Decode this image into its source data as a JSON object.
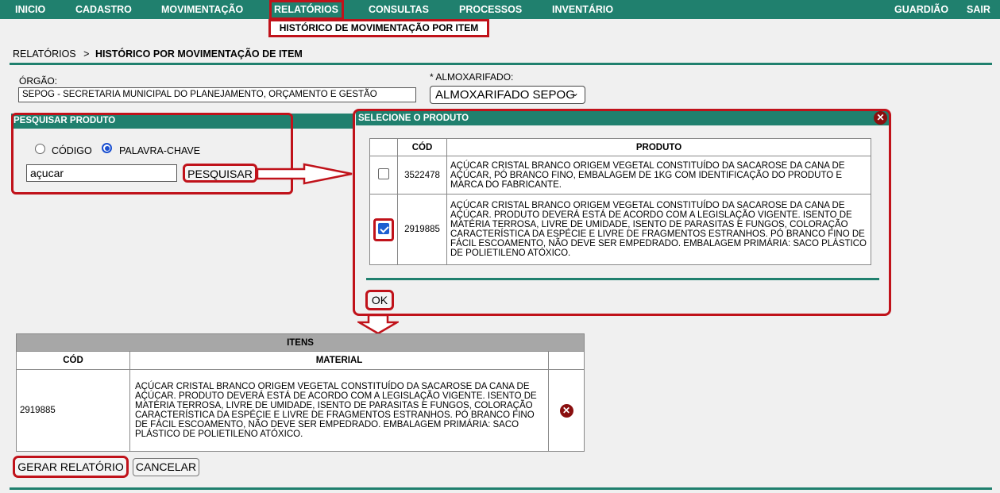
{
  "nav": {
    "items": [
      "INICIO",
      "CADASTRO",
      "MOVIMENTAÇÃO",
      "RELATÓRIOS",
      "CONSULTAS",
      "PROCESSOS",
      "INVENTÁRIO"
    ],
    "right": [
      "GUARDIÃO",
      "SAIR"
    ],
    "submenu": "HISTÓRICO DE MOVIMENTAÇÃO POR ITEM"
  },
  "breadcrumb": {
    "root": "RELATÓRIOS",
    "sep": ">",
    "current": "HISTÓRICO POR MOVIMENTAÇÃO DE ITEM"
  },
  "form": {
    "orgao_label": "ÓRGÃO:",
    "orgao_value": "SEPOG - SECRETARIA MUNICIPAL DO PLANEJAMENTO, ORÇAMENTO E GESTÃO",
    "almox_label": "* ALMOXARIFADO:",
    "almox_value": "ALMOXARIFADO SEPOG"
  },
  "search": {
    "title": "PESQUISAR PRODUTO",
    "opt_codigo": "CÓDIGO",
    "opt_palavra": "PALAVRA-CHAVE",
    "selected_option": "PALAVRA-CHAVE",
    "query": "açucar",
    "button": "PESQUISAR"
  },
  "modal": {
    "title": "SELECIONE O PRODUTO",
    "col_cod": "CÓD",
    "col_produto": "PRODUTO",
    "rows": [
      {
        "checked": false,
        "cod": "3522478",
        "produto": "AÇÚCAR CRISTAL BRANCO ORIGEM VEGETAL CONSTITUÍDO DA SACAROSE DA CANA DE AÇÚCAR, PÓ BRANCO FINO, EMBALAGEM DE 1KG COM IDENTIFICAÇÃO DO PRODUTO E MARCA DO FABRICANTE."
      },
      {
        "checked": true,
        "cod": "2919885",
        "produto": "AÇÚCAR CRISTAL BRANCO ORIGEM VEGETAL CONSTITUÍDO DA SACAROSE DA CANA DE AÇÚCAR. PRODUTO DEVERÁ ESTÁ DE ACORDO COM A LEGISLAÇÃO VIGENTE. ISENTO DE MATÉRIA TERROSA, LIVRE DE UMIDADE, ISENTO DE PARASITAS E FUNGOS, COLORAÇÃO CARACTERÍSTICA DA ESPÉCIE E LIVRE DE FRAGMENTOS ESTRANHOS. PÓ BRANCO FINO DE FÁCIL ESCOAMENTO, NÃO DEVE SER EMPEDRADO. EMBALAGEM PRIMÁRIA: SACO PLÁSTICO DE POLIETILENO ATÓXICO."
      }
    ],
    "ok": "OK"
  },
  "itens": {
    "title": "ITENS",
    "col_cod": "CÓD",
    "col_material": "MATERIAL",
    "rows": [
      {
        "cod": "2919885",
        "material": "AÇÚCAR CRISTAL BRANCO ORIGEM VEGETAL CONSTITUÍDO DA SACAROSE DA CANA DE AÇÚCAR. PRODUTO DEVERÁ ESTÁ DE ACORDO COM A LEGISLAÇÃO VIGENTE. ISENTO DE MATÉRIA TERROSA, LIVRE DE UMIDADE, ISENTO DE PARASITAS E FUNGOS, COLORAÇÃO CARACTERÍSTICA DA ESPÉCIE E LIVRE DE FRAGMENTOS ESTRANHOS. PÓ BRANCO FINO DE FÁCIL ESCOAMENTO, NÃO DEVE SER EMPEDRADO. EMBALAGEM PRIMÁRIA: SACO PLÁSTICO DE POLIETILENO ATÓXICO."
      }
    ]
  },
  "actions": {
    "gerar": "GERAR RELATÓRIO",
    "cancelar": "CANCELAR"
  },
  "colors": {
    "brand": "#20806e",
    "highlight": "#c0121a",
    "check": "#1d5fd1",
    "remove": "#8a0f0f"
  },
  "icons": {
    "close": "close-icon",
    "remove": "remove-icon",
    "arrow_right": "arrow-right-icon",
    "arrow_down": "arrow-down-icon"
  }
}
